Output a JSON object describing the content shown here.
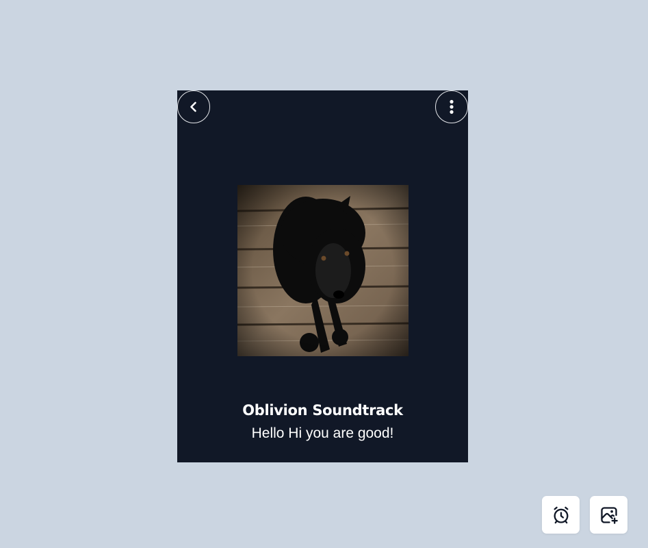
{
  "player": {
    "title": "Oblivion Soundtrack",
    "subtitle": "Hello Hi you are good!",
    "artwork_alt": "Black dog sitting on wooden floor"
  },
  "controls": {
    "back_icon": "chevron-left-icon",
    "more_icon": "dots-vertical-icon"
  },
  "actions": {
    "alarm_icon": "alarm-clock-icon",
    "add_photo_icon": "image-plus-icon"
  },
  "colors": {
    "background": "#cbd5e1",
    "card": "#111827",
    "text": "#ffffff"
  }
}
